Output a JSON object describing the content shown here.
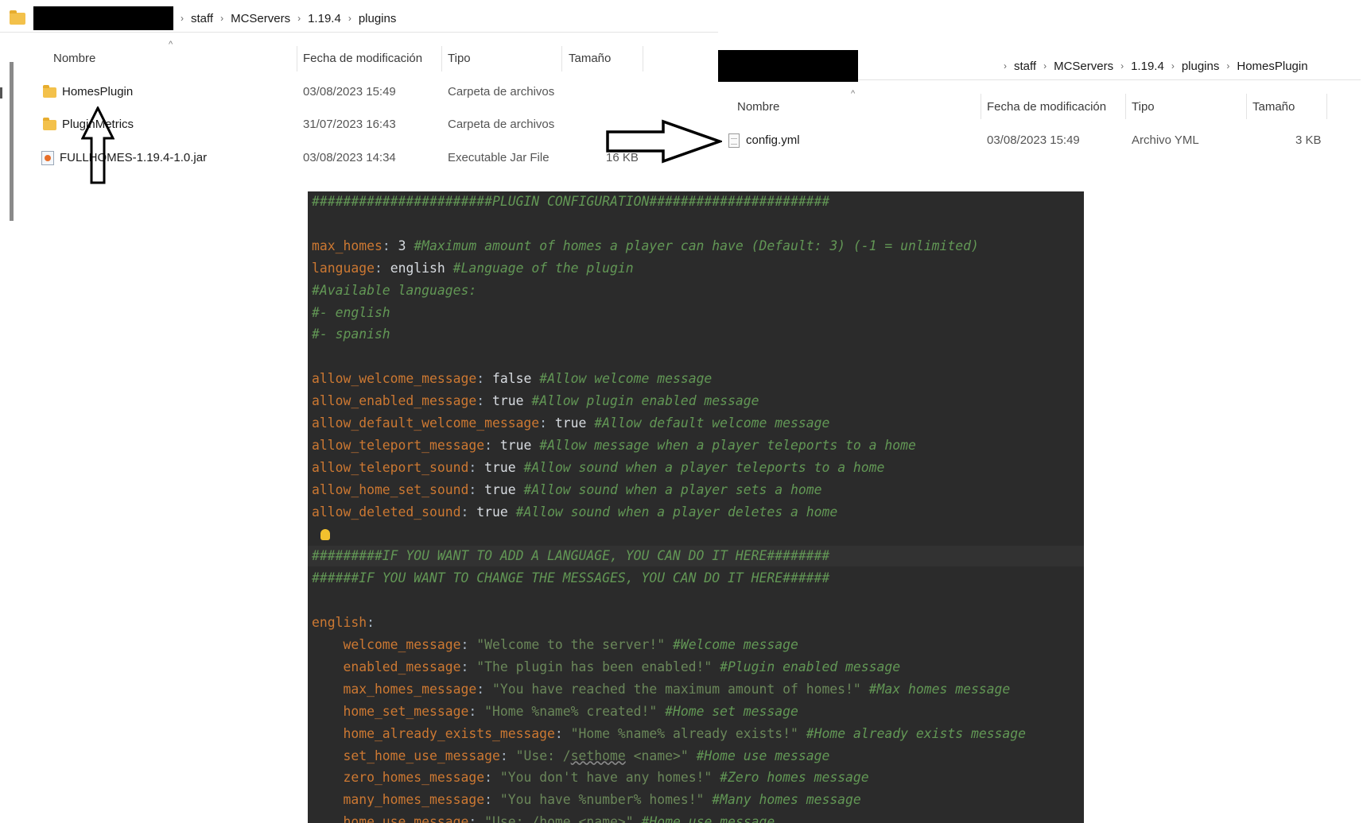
{
  "explorer_left": {
    "breadcrumbs": [
      "staff",
      "MCServers",
      "1.19.4",
      "plugins"
    ],
    "columns": {
      "name": "Nombre",
      "date": "Fecha de modificación",
      "type": "Tipo",
      "size": "Tamaño"
    },
    "rows": [
      {
        "icon": "folder-icon",
        "name": "HomesPlugin",
        "date": "03/08/2023 15:49",
        "type": "Carpeta de archivos",
        "size": ""
      },
      {
        "icon": "folder-icon",
        "name": "PluginMetrics",
        "date": "31/07/2023 16:43",
        "type": "Carpeta de archivos",
        "size": ""
      },
      {
        "icon": "jar-file-icon",
        "name": "FULLHOMES-1.19.4-1.0.jar",
        "date": "03/08/2023 14:34",
        "type": "Executable Jar File",
        "size": "16 KB"
      }
    ]
  },
  "explorer_right": {
    "breadcrumbs": [
      "staff",
      "MCServers",
      "1.19.4",
      "plugins",
      "HomesPlugin"
    ],
    "columns": {
      "name": "Nombre",
      "date": "Fecha de modificación",
      "type": "Tipo",
      "size": "Tamaño"
    },
    "rows": [
      {
        "icon": "document-icon",
        "name": "config.yml",
        "date": "03/08/2023 15:49",
        "type": "Archivo YML",
        "size": "3 KB"
      }
    ]
  },
  "editor": {
    "lines": [
      {
        "parts": [
          {
            "t": "#######################PLUGIN CONFIGURATION#######################",
            "c": "c"
          }
        ]
      },
      {
        "parts": []
      },
      {
        "parts": [
          {
            "t": "max_homes",
            "c": "k"
          },
          {
            "t": ": ",
            "c": "p"
          },
          {
            "t": "3 ",
            "c": "v"
          },
          {
            "t": "#Maximum amount of homes a player can have (Default: 3) (-1 = unlimited)",
            "c": "c"
          }
        ]
      },
      {
        "parts": [
          {
            "t": "language",
            "c": "k"
          },
          {
            "t": ": ",
            "c": "p"
          },
          {
            "t": "english ",
            "c": "v"
          },
          {
            "t": "#Language of the plugin",
            "c": "c"
          }
        ]
      },
      {
        "parts": [
          {
            "t": "#Available languages:",
            "c": "c"
          }
        ]
      },
      {
        "parts": [
          {
            "t": "#- english",
            "c": "c"
          }
        ]
      },
      {
        "parts": [
          {
            "t": "#- spanish",
            "c": "c"
          }
        ]
      },
      {
        "parts": []
      },
      {
        "parts": [
          {
            "t": "allow_welcome_message",
            "c": "k"
          },
          {
            "t": ": ",
            "c": "p"
          },
          {
            "t": "false ",
            "c": "v"
          },
          {
            "t": "#Allow welcome message",
            "c": "c"
          }
        ]
      },
      {
        "parts": [
          {
            "t": "allow_enabled_message",
            "c": "k"
          },
          {
            "t": ": ",
            "c": "p"
          },
          {
            "t": "true ",
            "c": "v"
          },
          {
            "t": "#Allow plugin enabled message",
            "c": "c"
          }
        ]
      },
      {
        "parts": [
          {
            "t": "allow_default_welcome_message",
            "c": "k"
          },
          {
            "t": ": ",
            "c": "p"
          },
          {
            "t": "true ",
            "c": "v"
          },
          {
            "t": "#Allow default welcome message",
            "c": "c"
          }
        ]
      },
      {
        "parts": [
          {
            "t": "allow_teleport_message",
            "c": "k"
          },
          {
            "t": ": ",
            "c": "p"
          },
          {
            "t": "true ",
            "c": "v"
          },
          {
            "t": "#Allow message when a player teleports to a home",
            "c": "c"
          }
        ]
      },
      {
        "parts": [
          {
            "t": "allow_teleport_sound",
            "c": "k"
          },
          {
            "t": ": ",
            "c": "p"
          },
          {
            "t": "true ",
            "c": "v"
          },
          {
            "t": "#Allow sound when a player teleports to a home",
            "c": "c"
          }
        ]
      },
      {
        "parts": [
          {
            "t": "allow_home_set_sound",
            "c": "k"
          },
          {
            "t": ": ",
            "c": "p"
          },
          {
            "t": "true ",
            "c": "v"
          },
          {
            "t": "#Allow sound when a player sets a home",
            "c": "c"
          }
        ]
      },
      {
        "parts": [
          {
            "t": "allow_deleted_sound",
            "c": "k"
          },
          {
            "t": ": ",
            "c": "p"
          },
          {
            "t": "true ",
            "c": "v"
          },
          {
            "t": "#Allow sound when a player deletes a home",
            "c": "c"
          }
        ]
      },
      {
        "parts": [],
        "bulb": true
      },
      {
        "parts": [
          {
            "t": "#########IF YOU WANT TO ADD A LANGUAGE, YOU CAN DO IT HERE########",
            "c": "c"
          }
        ],
        "highlight": true
      },
      {
        "parts": [
          {
            "t": "######IF YOU WANT TO CHANGE THE MESSAGES, YOU CAN DO IT HERE######",
            "c": "c"
          }
        ]
      },
      {
        "parts": []
      },
      {
        "parts": [
          {
            "t": "english",
            "c": "k"
          },
          {
            "t": ":",
            "c": "p"
          }
        ]
      },
      {
        "parts": [
          {
            "t": "    welcome_message",
            "c": "k"
          },
          {
            "t": ": ",
            "c": "p"
          },
          {
            "t": "\"Welcome to the server!\" ",
            "c": "s"
          },
          {
            "t": "#Welcome message",
            "c": "c"
          }
        ]
      },
      {
        "parts": [
          {
            "t": "    enabled_message",
            "c": "k"
          },
          {
            "t": ": ",
            "c": "p"
          },
          {
            "t": "\"The plugin has been enabled!\" ",
            "c": "s"
          },
          {
            "t": "#Plugin enabled message",
            "c": "c"
          }
        ]
      },
      {
        "parts": [
          {
            "t": "    max_homes_message",
            "c": "k"
          },
          {
            "t": ": ",
            "c": "p"
          },
          {
            "t": "\"You have reached the maximum amount of homes!\" ",
            "c": "s"
          },
          {
            "t": "#Max homes message",
            "c": "c"
          }
        ]
      },
      {
        "parts": [
          {
            "t": "    home_set_message",
            "c": "k"
          },
          {
            "t": ": ",
            "c": "p"
          },
          {
            "t": "\"Home %name% created!\" ",
            "c": "s"
          },
          {
            "t": "#Home set message",
            "c": "c"
          }
        ]
      },
      {
        "parts": [
          {
            "t": "    home_already_exists_message",
            "c": "k"
          },
          {
            "t": ": ",
            "c": "p"
          },
          {
            "t": "\"Home %name% already exists!\" ",
            "c": "s"
          },
          {
            "t": "#Home already exists message",
            "c": "c"
          }
        ]
      },
      {
        "parts": [
          {
            "t": "    set_home_use_message",
            "c": "k"
          },
          {
            "t": ": ",
            "c": "p"
          },
          {
            "t": "\"Use: /",
            "c": "s"
          },
          {
            "t": "sethome",
            "c": "s u"
          },
          {
            "t": " <name>\" ",
            "c": "s"
          },
          {
            "t": "#Home use message",
            "c": "c"
          }
        ]
      },
      {
        "parts": [
          {
            "t": "    zero_homes_message",
            "c": "k"
          },
          {
            "t": ": ",
            "c": "p"
          },
          {
            "t": "\"You don't have any homes!\" ",
            "c": "s"
          },
          {
            "t": "#Zero homes message",
            "c": "c"
          }
        ]
      },
      {
        "parts": [
          {
            "t": "    many_homes_message",
            "c": "k"
          },
          {
            "t": ": ",
            "c": "p"
          },
          {
            "t": "\"You have %number% homes!\" ",
            "c": "s"
          },
          {
            "t": "#Many homes message",
            "c": "c"
          }
        ]
      },
      {
        "parts": [
          {
            "t": "    home_use_message",
            "c": "k"
          },
          {
            "t": ": ",
            "c": "p"
          },
          {
            "t": "\"Use: /home <name>\" ",
            "c": "s"
          },
          {
            "t": "#Home use message",
            "c": "c"
          }
        ]
      }
    ]
  }
}
